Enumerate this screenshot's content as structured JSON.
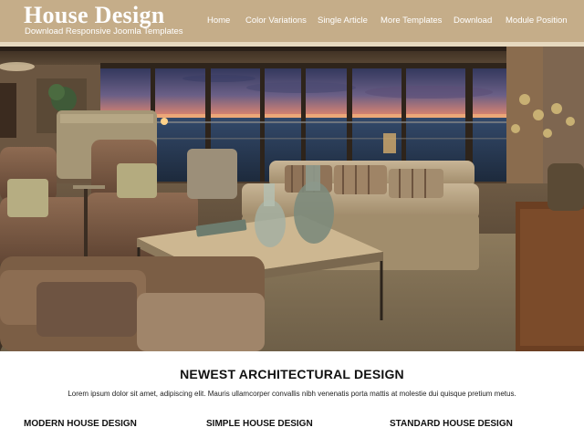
{
  "site": {
    "title": "House Design",
    "subtitle": "Download Responsive Joomla Templates"
  },
  "nav": {
    "items": [
      {
        "label": "Home"
      },
      {
        "label": "Color Variations"
      },
      {
        "label": "Single Article"
      },
      {
        "label": "More Templates"
      },
      {
        "label": "Download"
      },
      {
        "label": "Module Position"
      }
    ]
  },
  "hero": {
    "alt": "Living room interior with ocean sunset view"
  },
  "main": {
    "heading": "NEWEST ARCHITECTURAL DESIGN",
    "text": "Lorem ipsum dolor sit amet, adipiscing elit. Mauris ullamcorper convallis nibh venenatis porta mattis at molestie dui quisque pretium metus.",
    "columns": [
      {
        "title": "MODERN HOUSE DESIGN"
      },
      {
        "title": "SIMPLE HOUSE DESIGN"
      },
      {
        "title": "STANDARD HOUSE DESIGN"
      }
    ]
  },
  "colors": {
    "header_bg": "#c5ad89",
    "header_line": "#e7d9bf",
    "text_dark": "#111111"
  }
}
